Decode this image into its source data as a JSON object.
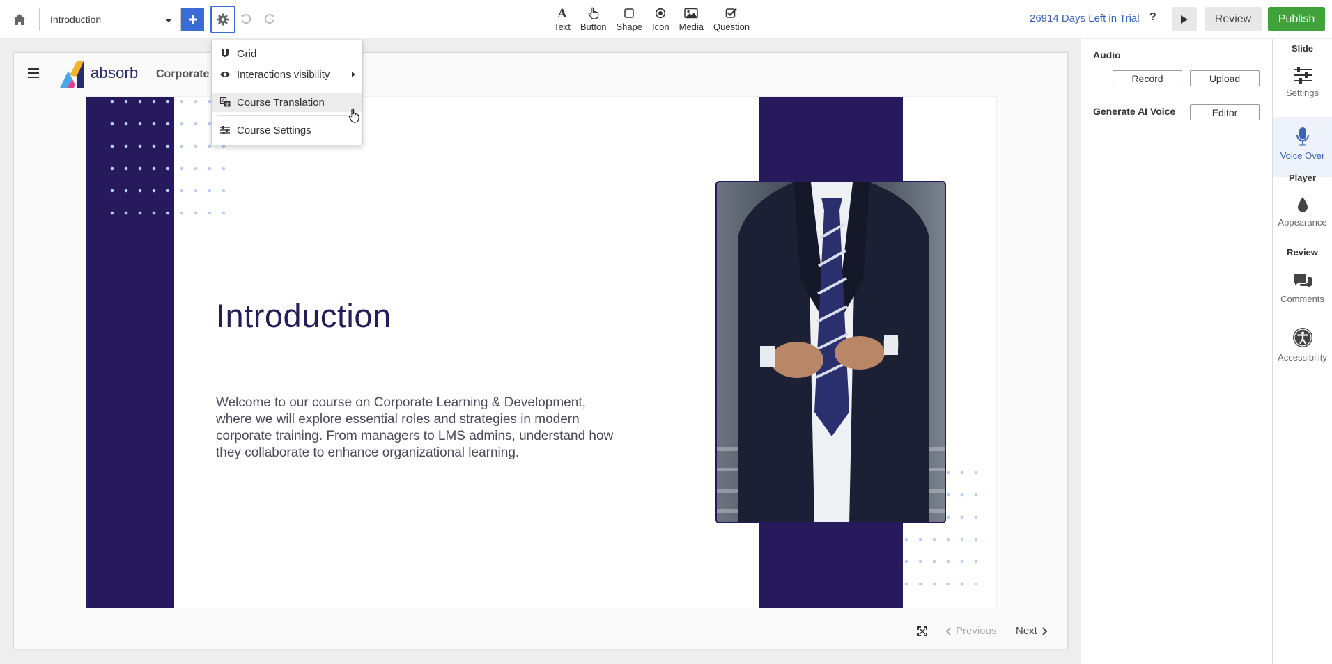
{
  "toolbar": {
    "slide_select": "Introduction",
    "tools": [
      {
        "label": "Text",
        "icon": "text-icon"
      },
      {
        "label": "Button",
        "icon": "pointer-hand-icon"
      },
      {
        "label": "Shape",
        "icon": "square-icon"
      },
      {
        "label": "Icon",
        "icon": "target-icon"
      },
      {
        "label": "Media",
        "icon": "image-icon"
      },
      {
        "label": "Question",
        "icon": "checkbox-icon"
      }
    ],
    "trial_text": "26914 Days Left in Trial",
    "help": "?",
    "review": "Review",
    "publish": "Publish"
  },
  "settings_menu": {
    "items": [
      {
        "label": "Grid",
        "icon": "magnet-icon"
      },
      {
        "label": "Interactions visibility",
        "icon": "eye-icon"
      },
      {
        "label": "Course Translation",
        "icon": "translate-icon"
      },
      {
        "label": "Course Settings",
        "icon": "sliders-icon"
      }
    ]
  },
  "course": {
    "brand": "absorb",
    "title": "Corporate",
    "slide_title": "Introduction",
    "slide_body": "Welcome to our course on Corporate Learning & Development, where we will explore essential roles and strategies in modern corporate training. From managers to LMS admins, understand how they collaborate to enhance organizational learning.",
    "prev": "Previous",
    "next": "Next"
  },
  "properties": {
    "audio_label": "Audio",
    "record": "Record",
    "upload": "Upload",
    "ai_voice_label": "Generate AI Voice",
    "editor": "Editor"
  },
  "rail": {
    "slide_section": "Slide",
    "settings": "Settings",
    "voice_over": "Voice Over",
    "player_section": "Player",
    "appearance": "Appearance",
    "review_section": "Review",
    "comments": "Comments",
    "accessibility": "Accessibility"
  },
  "colors": {
    "accent": "#3b6bd6",
    "publish": "#3fa23b",
    "brand_navy": "#271a5c"
  }
}
